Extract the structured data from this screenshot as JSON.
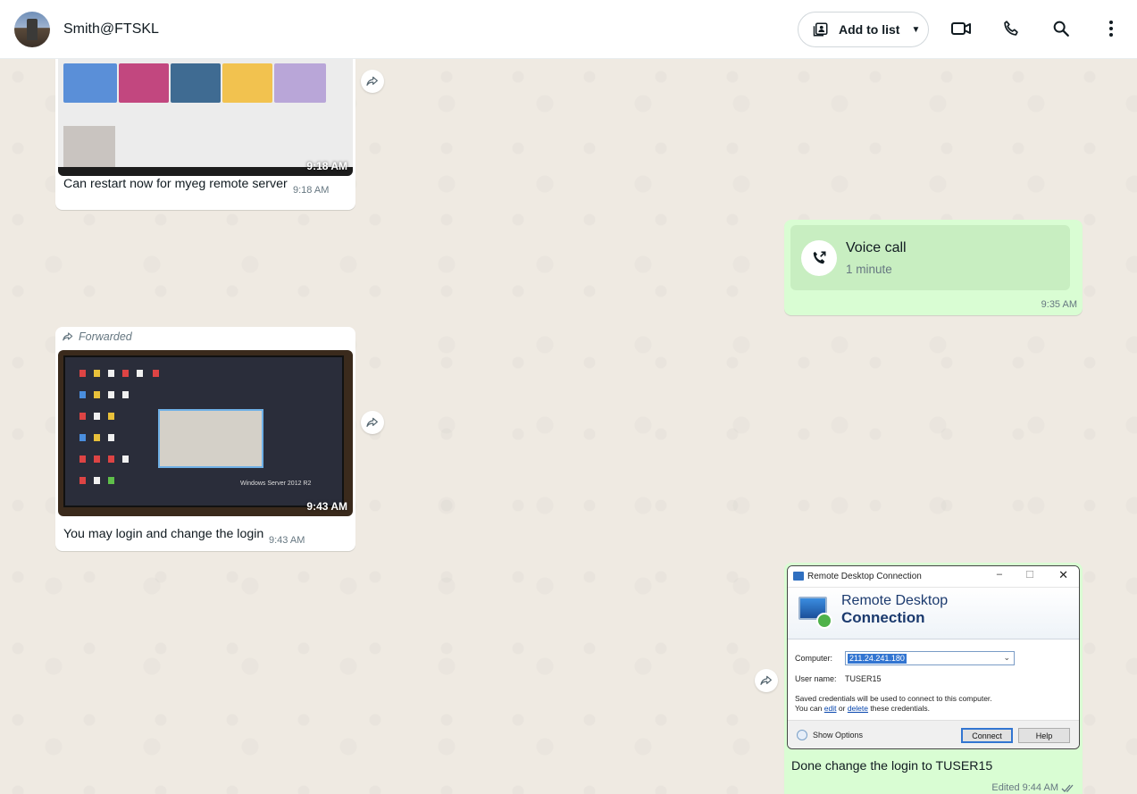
{
  "header": {
    "contact_name": "Smith@FTSKL",
    "add_to_list_label": "Add to list"
  },
  "messages": {
    "m1": {
      "image_time": "9:18 AM",
      "text": "Can restart now for myeg remote server",
      "time": "9:18 AM"
    },
    "m2": {
      "title": "Voice call",
      "duration": "1 minute",
      "time": "9:35 AM"
    },
    "m3": {
      "forwarded_label": "Forwarded",
      "image_time": "9:43 AM",
      "text": "You may login and change the login",
      "time": "9:43 AM",
      "screen_caption": "Windows Server 2012 R2"
    },
    "m4": {
      "rdc": {
        "window_title": "Remote Desktop Connection",
        "banner_line1": "Remote Desktop",
        "banner_line2": "Connection",
        "computer_label": "Computer:",
        "computer_value": "211.24.241.180",
        "username_label": "User name:",
        "username_value": "TUSER15",
        "saved_line1": "Saved credentials will be used to connect to this computer.",
        "saved_prefix": "You can",
        "edit_link": "edit",
        "or_text": "or",
        "delete_link": "delete",
        "saved_suffix": "these credentials.",
        "show_options": "Show Options",
        "connect_button": "Connect",
        "help_button": "Help"
      },
      "text": "Done change the login to TUSER15",
      "time": "Edited 9:44 AM"
    }
  },
  "colors": {
    "chat_bg": "#efeae2",
    "incoming_bubble": "#ffffff",
    "outgoing_bubble": "#d9fdd3",
    "read_ticks": "#667781"
  }
}
